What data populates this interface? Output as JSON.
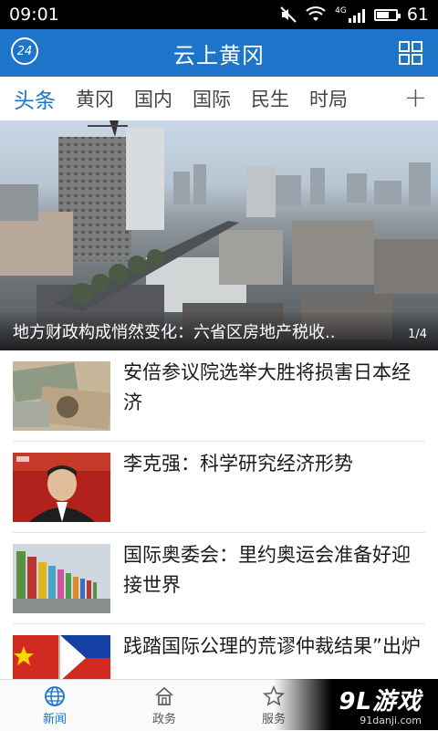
{
  "status_bar": {
    "time": "09:01",
    "network": "4G",
    "battery_level": "61"
  },
  "app": {
    "title": "云上黄冈",
    "logo_text": "24"
  },
  "tabs": [
    {
      "label": "头条",
      "active": true
    },
    {
      "label": "黄冈",
      "active": false
    },
    {
      "label": "国内",
      "active": false
    },
    {
      "label": "国际",
      "active": false
    },
    {
      "label": "民生",
      "active": false
    },
    {
      "label": "时局",
      "active": false
    }
  ],
  "tab_add_label": "+",
  "hero": {
    "caption": "地方财政构成悄然变化：六省区房地产税收..",
    "pager": "1/4"
  },
  "news": [
    {
      "title": "安倍参议院选举大胜将损害日本经济",
      "thumb": "banknotes"
    },
    {
      "title": "李克强：科学研究经济形势",
      "thumb": "premier"
    },
    {
      "title": "国际奥委会：里约奥运会准备好迎接世界",
      "thumb": "flags"
    },
    {
      "title": "践踏国际公理的荒谬仲裁结果”出炉",
      "thumb": "flags-philippines"
    }
  ],
  "bottom_nav": [
    {
      "label": "新闻",
      "icon": "globe-icon",
      "active": true
    },
    {
      "label": "政务",
      "icon": "government-icon",
      "active": false
    },
    {
      "label": "服务",
      "icon": "service-icon",
      "active": false
    }
  ],
  "watermark": {
    "main": "9L游戏",
    "sub": "91danji.com"
  },
  "colors": {
    "primary": "#1d74c9",
    "status_bar": "#000000"
  }
}
